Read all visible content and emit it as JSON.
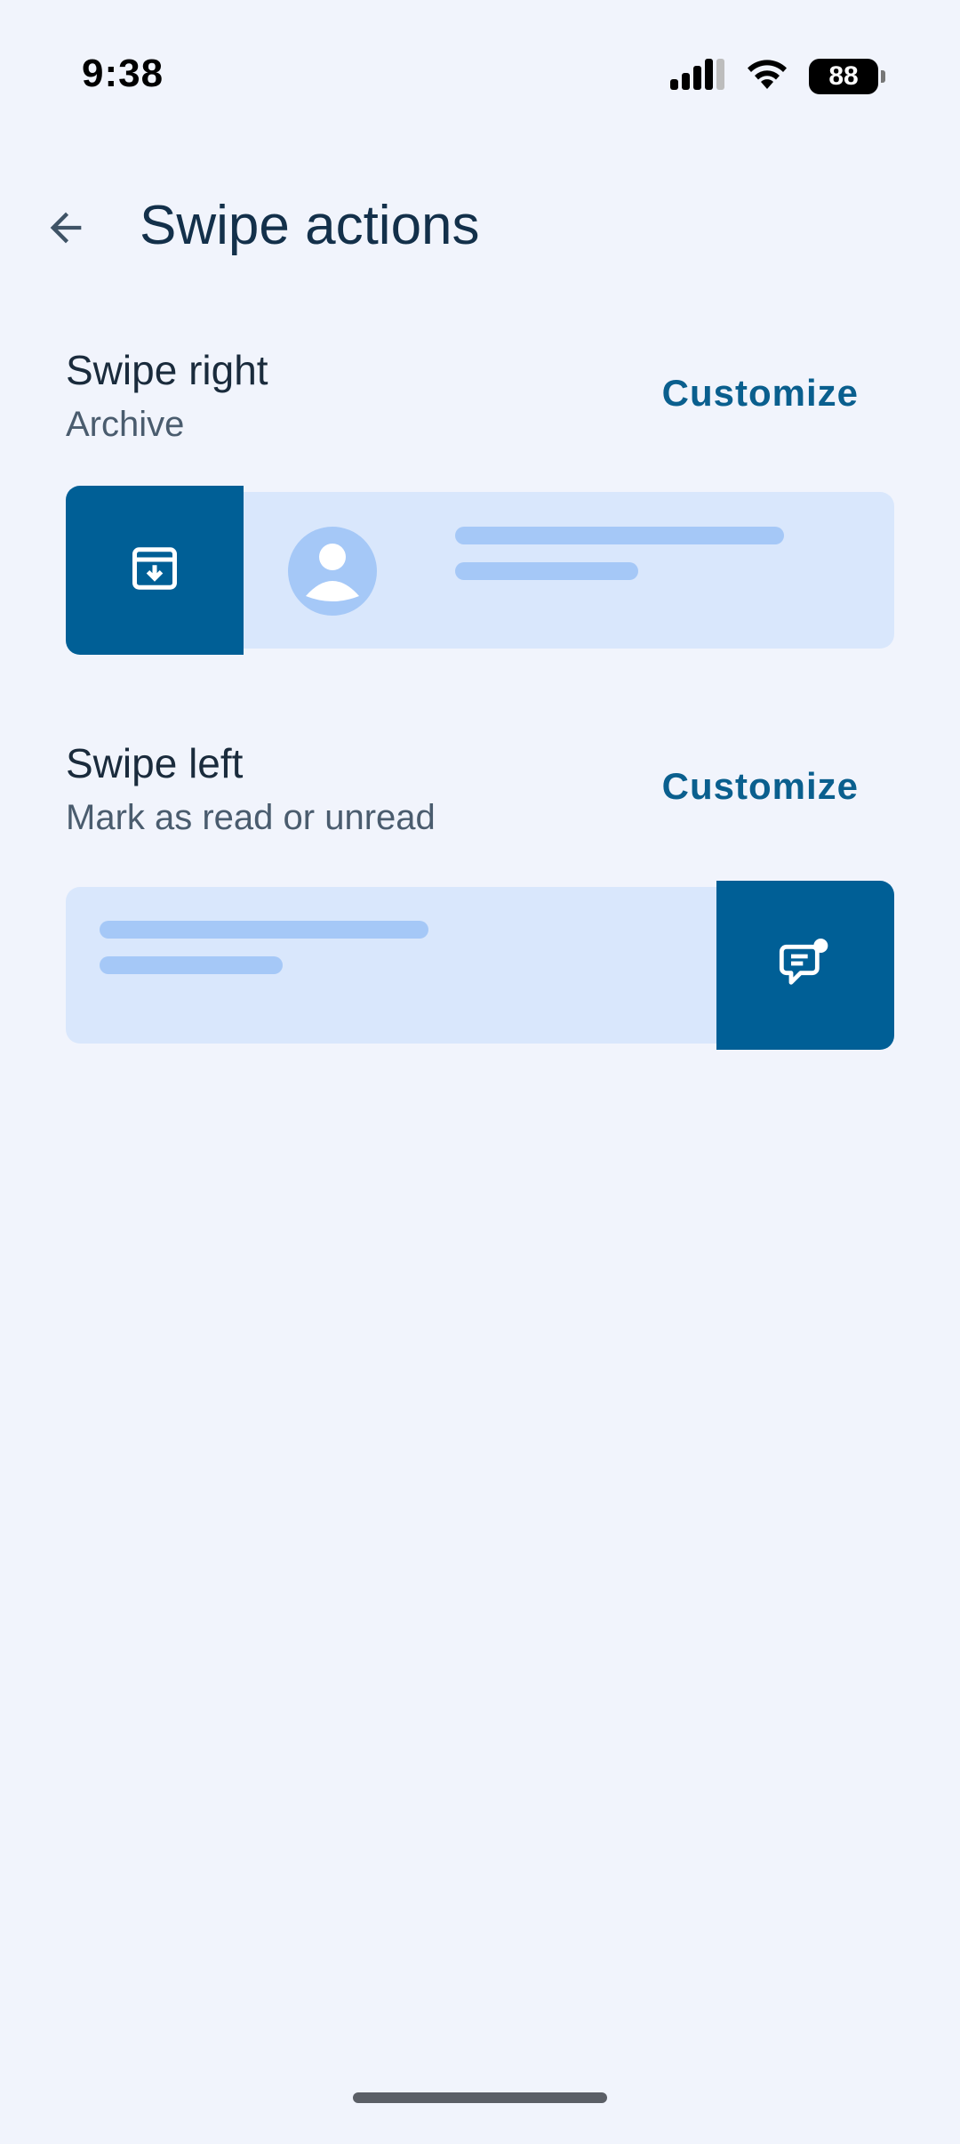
{
  "status_bar": {
    "time": "9:38",
    "battery": "88",
    "icons": [
      "signal-icon",
      "wifi-icon",
      "battery-icon"
    ]
  },
  "app_bar": {
    "title": "Swipe actions",
    "back_icon": "arrow-back-icon"
  },
  "swipe_right": {
    "title": "Swipe right",
    "action": "Archive",
    "customize_label": "Customize",
    "action_icon": "archive-icon"
  },
  "swipe_left": {
    "title": "Swipe left",
    "action": "Mark as read or unread",
    "customize_label": "Customize",
    "action_icon": "mark-read-unread-icon"
  },
  "colors": {
    "background": "#f1f4fc",
    "accent": "#0a5f8e",
    "action_block": "#005f96",
    "preview_card": "#d9e7fc",
    "placeholder": "#a5c8f7"
  }
}
